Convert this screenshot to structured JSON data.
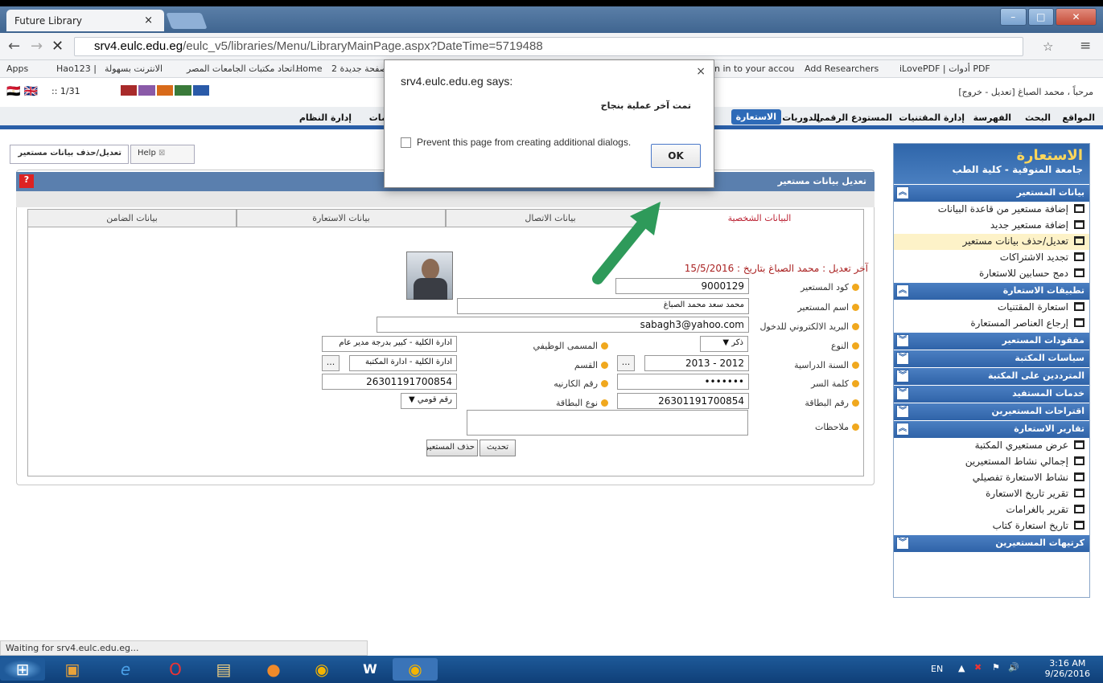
{
  "browser": {
    "tab_title": "Future Library",
    "url_host": "srv4.eulc.edu.eg",
    "url_path": "/eulc_v5/libraries/Menu/LibraryMainPage.aspx?DateTime=5719488",
    "bookmarks": [
      "Apps",
      "Hao123 |",
      "الانترنت بسهولة",
      "اتحاد مكتبات الجامعات المصر...",
      "Home",
      "صفحة جديدة 2",
      "n in to your accou",
      "Add Researchers",
      "iLovePDF | أدوات PDF"
    ]
  },
  "page": {
    "welcome": "مرحباً ، محمد الصباغ [تعديل - خروج]",
    "counter": ":: 1/31",
    "menu": [
      "المواقع",
      "البحث",
      "الفهرسة",
      "إدارة المقتنيات",
      "المستودع الرقمي",
      "الدوريات",
      "الاستعارة",
      "خدمات",
      "إدارة النظام"
    ]
  },
  "sidebar": {
    "title": "الاستعارة",
    "subtitle": "جامعة المنوفية - كلية الطب",
    "sections": [
      {
        "label": "بيانات المستعير",
        "open": true,
        "items": [
          "إضافة مستعير من قاعدة البيانات",
          "إضافة مستعير جديد",
          "تعديل/حذف بيانات مستعير",
          "تجديد الاشتراكات",
          "دمج حسابين للاستعارة"
        ]
      },
      {
        "label": "تطبيقات الاستعارة",
        "open": true,
        "items": [
          "استعارة المقتنيات",
          "إرجاع العناصر المستعارة"
        ]
      },
      {
        "label": "مفقودات المستعير",
        "open": false,
        "items": []
      },
      {
        "label": "سياسات المكتبة",
        "open": false,
        "items": []
      },
      {
        "label": "المترددين على المكتبة",
        "open": false,
        "items": []
      },
      {
        "label": "خدمات المستفيد",
        "open": false,
        "items": []
      },
      {
        "label": "اقتراحات المستعيرين",
        "open": false,
        "items": []
      },
      {
        "label": "تقارير الاستعارة",
        "open": true,
        "items": [
          "عرض مستعيري المكتبة",
          "إجمالي نشاط المستعيرين",
          "نشاط الاستعارة تفصيلي",
          "تقرير تاريخ الاستعارة",
          "تقرير بالغرامات",
          "تاريخ استعارة كتاب"
        ]
      },
      {
        "label": "كرتيهات المستعيرين",
        "open": false,
        "items": []
      }
    ]
  },
  "work": {
    "tab_help": "Help",
    "tab_active": "تعديل/حذف بيانات مستعير",
    "panel_title": "تعديل بيانات مستعير",
    "subtabs": [
      "البيانات الشخصية",
      "بيانات الاتصال",
      "بيانات الاستعارة",
      "بيانات الضامن"
    ],
    "last_edit": "آخر تعديل : محمد الصباغ بتاريخ : 15/5/2016",
    "labels": {
      "code": "كود المستعير",
      "name": "اسم المستعير",
      "email": "البريد الالكتروني للدخول",
      "gender": "النوع",
      "year": "السنة الدراسية",
      "password": "كلمة السر",
      "card_no": "رقم البطاقة",
      "job": "المسمى الوظيفي",
      "dept": "القسم",
      "card_no2": "رقم الكارنيه",
      "card_type": "نوع البطاقة",
      "notes": "ملاحظات"
    },
    "values": {
      "code": "9000129",
      "name": "محمد سعد محمد الصباغ",
      "email": "sabagh3@yahoo.com",
      "gender": "ذكر ▼",
      "year": "2013 - 2012",
      "password": "•••••••",
      "card_no": "26301191700854",
      "job": "ادارة الكلية - كبير بدرجة مدير عام",
      "dept": "ادارة الكلية - ادارة المكتبة",
      "card_no2": "26301191700854",
      "card_type": "رقم قومي ▼"
    },
    "btn_update": "تحديث",
    "btn_delete": "حذف المستعير نهائياً"
  },
  "dialog": {
    "title": "srv4.eulc.edu.eg says:",
    "message": "تمت آخر عملية بنجاح",
    "checkbox": "Prevent this page from creating additional dialogs.",
    "ok": "OK"
  },
  "status": "Waiting for srv4.eulc.edu.eg...",
  "tray": {
    "lang": "EN",
    "time": "3:16 AM",
    "date": "9/26/2016"
  }
}
